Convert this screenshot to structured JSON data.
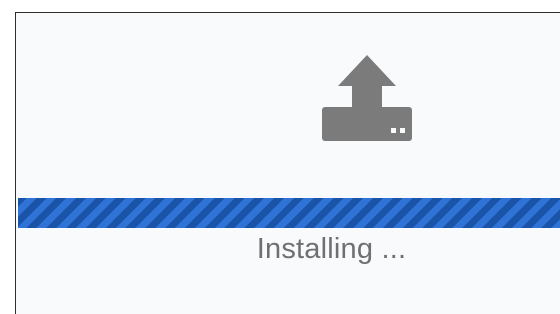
{
  "icon": {
    "name": "upload-icon",
    "color": "#7b7b7b"
  },
  "progress": {
    "value": 1.0,
    "track_color": "#1f5fb8",
    "stripe_colors": [
      "#2f73d6",
      "#1a54a8"
    ]
  },
  "status": {
    "text": "Installing ..."
  }
}
